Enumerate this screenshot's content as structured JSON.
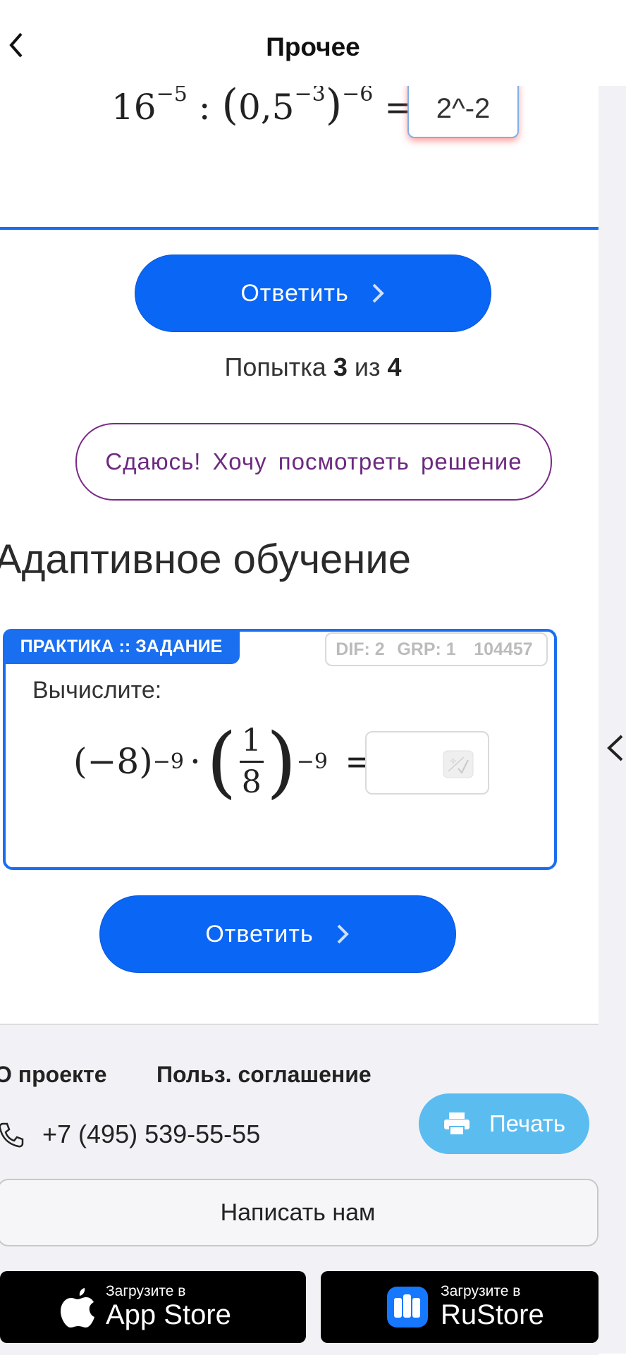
{
  "header": {
    "title": "Прочее"
  },
  "task1": {
    "base": "16",
    "exp1": "−5",
    "op": ":",
    "inner_base": "0,5",
    "exp2": "−3",
    "exp3": "−6",
    "equals": "=",
    "answer_value": "2^-2"
  },
  "answer_button": {
    "label": "Ответить"
  },
  "attempt": {
    "prefix": "Попытка",
    "current": "3",
    "mid": "из",
    "total": "4"
  },
  "giveup_button": {
    "label": "Сдаюсь! Хочу посмотреть решение"
  },
  "section": {
    "title": "Адаптивное обучение"
  },
  "practice": {
    "tag": "ПРАКТИКА :: ЗАДАНИЕ",
    "dif": "DIF: 2",
    "grp": "GRP: 1",
    "id": "104457",
    "prompt": "Вычислите:",
    "expr": {
      "base": "(−8)",
      "exp1": "−9",
      "dot": "·",
      "num": "1",
      "den": "8",
      "exp2": "−9",
      "equals": "="
    },
    "answer_value": ""
  },
  "answer_button2": {
    "label": "Ответить"
  },
  "footer": {
    "link_about": "О проекте",
    "link_terms": "Польз. соглашение",
    "phone": "+7 (495) 539-55-55",
    "print_label": "Печать",
    "write_label": "Написать нам",
    "appstore": {
      "small": "Загрузите в",
      "big": "App Store"
    },
    "rustore": {
      "small": "Загрузите в",
      "big": "RuStore"
    }
  },
  "colors": {
    "primary": "#0a66f5",
    "giveup": "#6c2a80",
    "print": "#5bbcf0"
  }
}
